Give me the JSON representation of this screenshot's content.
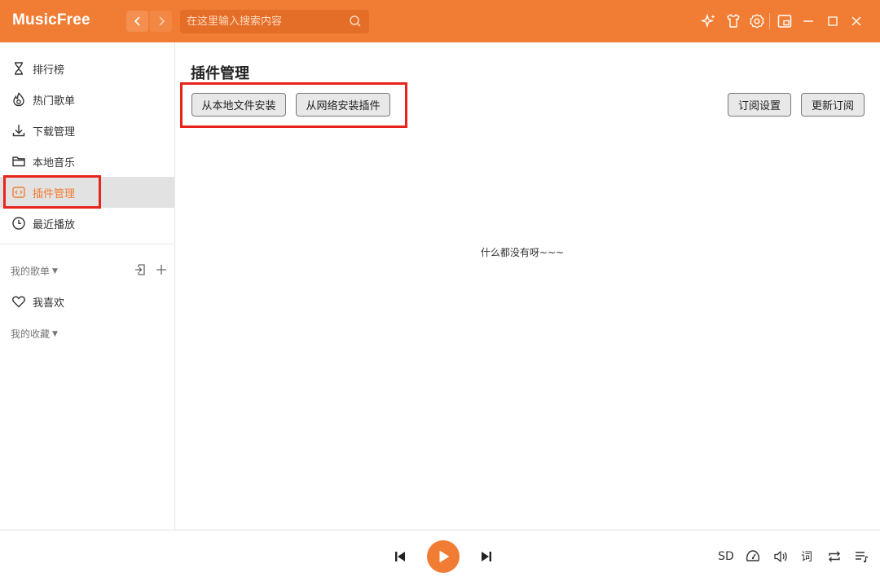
{
  "app": {
    "title": "MusicFree",
    "accent_color": "#f17d34"
  },
  "titlebar": {
    "back_icon": "chevron-left-icon",
    "forward_icon": "chevron-right-icon",
    "search_placeholder": "在这里输入搜索内容",
    "icons": [
      "sparkle-icon",
      "tshirt-icon",
      "gear-icon",
      "minimode-icon",
      "minimize-icon",
      "maximize-icon",
      "close-icon"
    ]
  },
  "sidebar": {
    "items": [
      {
        "label": "排行榜",
        "icon": "hourglass-icon"
      },
      {
        "label": "热门歌单",
        "icon": "fire-icon"
      },
      {
        "label": "下载管理",
        "icon": "download-icon"
      },
      {
        "label": "本地音乐",
        "icon": "folder-icon"
      },
      {
        "label": "插件管理",
        "icon": "plugin-icon",
        "active": true
      },
      {
        "label": "最近播放",
        "icon": "clock-icon"
      }
    ],
    "my_playlists": "我的歌单",
    "favorites": {
      "label": "我喜欢",
      "icon": "heart-icon"
    },
    "my_collections": "我的收藏"
  },
  "main": {
    "title": "插件管理",
    "buttons": {
      "install_local": "从本地文件安装",
      "install_network": "从网络安装插件",
      "subscription_settings": "订阅设置",
      "update_subscription": "更新订阅"
    },
    "empty_text": "什么都没有呀~~~"
  },
  "player": {
    "quality": "SD",
    "lyric": "词",
    "icons": [
      "previous-icon",
      "play-icon",
      "next-icon",
      "speed-icon",
      "volume-icon",
      "repeat-icon",
      "playlist-icon"
    ]
  }
}
